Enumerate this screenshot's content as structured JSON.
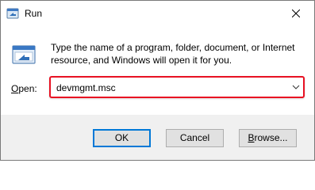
{
  "window": {
    "title": "Run",
    "app_icon": "run-app-icon",
    "close_icon": "close-icon"
  },
  "content": {
    "icon": "run-icon",
    "description": "Type the name of a program, folder, document, or Internet resource, and Windows will open it for you.",
    "open_label_underlined": "O",
    "open_label_rest": "pen:",
    "input_value": "devmgmt.msc",
    "dropdown_icon": "chevron-down-icon",
    "highlight_color": "#e81123"
  },
  "buttons": {
    "ok_label": "OK",
    "cancel_label": "Cancel",
    "browse_underlined": "B",
    "browse_rest": "rowse..."
  }
}
